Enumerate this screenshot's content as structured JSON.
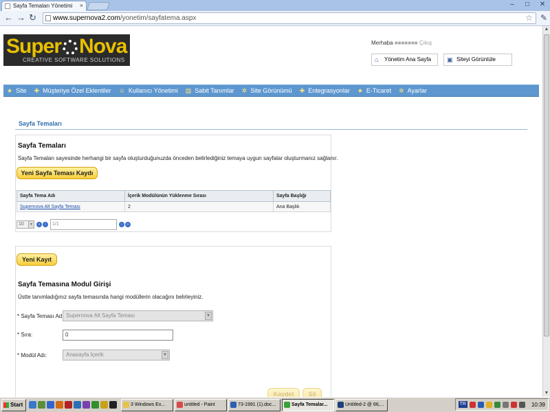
{
  "browser": {
    "tab_title": "Sayfa Temaları Yönetimi",
    "url_host": "www.supernova2.com",
    "url_path": "/yonetim/sayfatema.aspx"
  },
  "logo": {
    "super": "Super",
    "nova": "Nova",
    "tagline": "CREATIVE SOFTWARE SOLUTIONS"
  },
  "header": {
    "welcome_prefix": "Merhaba",
    "welcome_exit": "Çıkış",
    "admin_home": "Yönetim Ana Sayfa",
    "view_site": "Siteyi Görüntüle"
  },
  "menu": [
    {
      "label": "Site"
    },
    {
      "label": "Müşteriye Özel Eklentiler"
    },
    {
      "label": "Kullanıcı Yönetimi"
    },
    {
      "label": "Sabit Tanımlar"
    },
    {
      "label": "Site Görünümü"
    },
    {
      "label": "Entegrasyonlar"
    },
    {
      "label": "E-Ticaret"
    },
    {
      "label": "Ayarlar"
    }
  ],
  "section_title": "Sayfa Temaları",
  "panel1": {
    "heading": "Sayfa Temaları",
    "description": "Sayfa Temaları sayesinde herhangi bir sayfa oluşturduğunuzda önceden belirlediğiniz temaya uygun sayfalar oluşturmanız sağlanır.",
    "new_button": "Yeni Sayfa Teması Kaydı",
    "columns": [
      "Sayfa Tema Adı",
      "İçerik Modülünün Yüklenme Sırası",
      "Sayfa Başlığı"
    ],
    "rows": [
      {
        "name": "Supernova Alt Sayfa Teması",
        "order": "2",
        "title": "Ana Başlık"
      }
    ],
    "pager": {
      "page_size": "10",
      "page_info": "1/1"
    }
  },
  "panel2": {
    "new_button": "Yeni Kayıt",
    "heading": "Sayfa Temasına Modul Girişi",
    "description": "Üstte tanımladığınız sayfa temasında hangi modüllerin olacağını belirleyiniz.",
    "fields": {
      "theme_label": "* Sayfa Teması Adı:",
      "theme_value": "Supernova Alt Sayfa Teması",
      "order_label": "* Sıra:",
      "order_value": "0",
      "module_label": "* Modül Adı:",
      "module_value": "Anasayfa İçerik"
    },
    "save_button": "Kaydet",
    "delete_button": "Sil"
  },
  "taskbar": {
    "start": "Start",
    "tasks": [
      {
        "label": "3 Windows Ex..."
      },
      {
        "label": "untitled - Paint"
      },
      {
        "label": "73-1991 (1).doc..."
      },
      {
        "label": "Sayfa Temalar..."
      },
      {
        "label": "Untitled-2 @ 66,..."
      }
    ],
    "lang": "TR",
    "clock": "10:39"
  }
}
